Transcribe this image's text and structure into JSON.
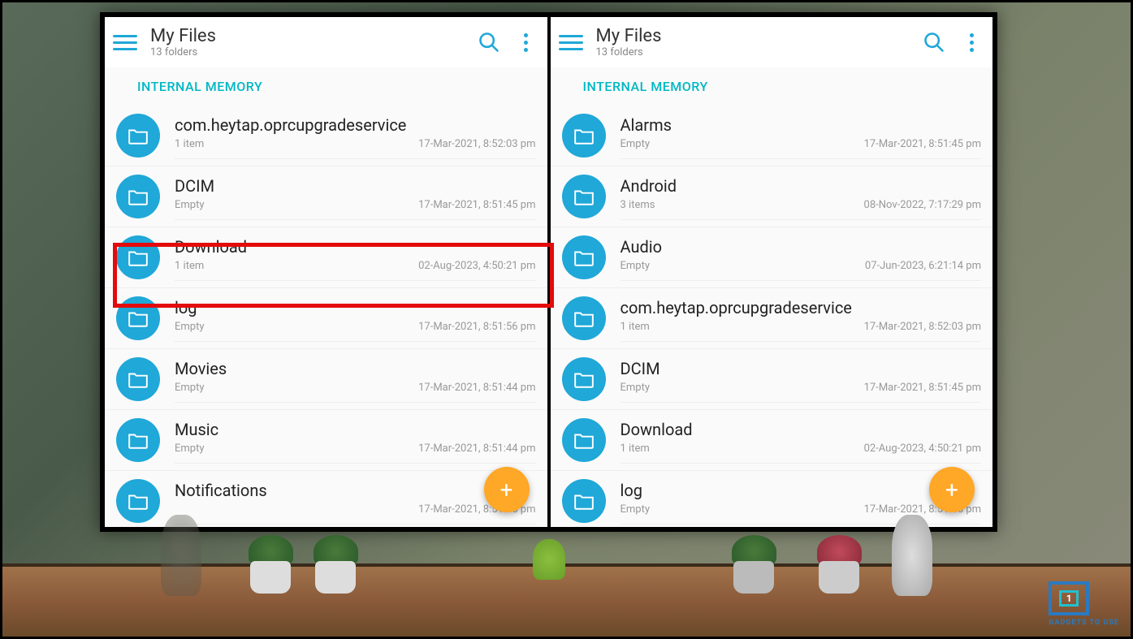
{
  "left": {
    "header": {
      "title": "My Files",
      "subtitle": "13 folders",
      "section": "INTERNAL MEMORY"
    },
    "items": [
      {
        "name": "com.heytap.oprcupgradeservice",
        "count": "1 item",
        "date": "17-Mar-2021, 8:52:03 pm"
      },
      {
        "name": "DCIM",
        "count": "Empty",
        "date": "17-Mar-2021, 8:51:45 pm"
      },
      {
        "name": "Download",
        "count": "1 item",
        "date": "02-Aug-2023, 4:50:21 pm"
      },
      {
        "name": "log",
        "count": "Empty",
        "date": "17-Mar-2021, 8:51:56 pm"
      },
      {
        "name": "Movies",
        "count": "Empty",
        "date": "17-Mar-2021, 8:51:44 pm"
      },
      {
        "name": "Music",
        "count": "Empty",
        "date": "17-Mar-2021, 8:51:44 pm"
      },
      {
        "name": "Notifications",
        "count": "",
        "date": "17-Mar-2021, 8:51:45 pm"
      }
    ]
  },
  "right": {
    "header": {
      "title": "My Files",
      "subtitle": "13 folders",
      "section": "INTERNAL MEMORY"
    },
    "items": [
      {
        "name": "Alarms",
        "count": "Empty",
        "date": "17-Mar-2021, 8:51:45 pm"
      },
      {
        "name": "Android",
        "count": "3 items",
        "date": "08-Nov-2022, 7:17:29 pm"
      },
      {
        "name": "Audio",
        "count": "Empty",
        "date": "07-Jun-2023, 6:21:14 pm"
      },
      {
        "name": "com.heytap.oprcupgradeservice",
        "count": "1 item",
        "date": "17-Mar-2021, 8:52:03 pm"
      },
      {
        "name": "DCIM",
        "count": "Empty",
        "date": "17-Mar-2021, 8:51:45 pm"
      },
      {
        "name": "Download",
        "count": "1 item",
        "date": "02-Aug-2023, 4:50:21 pm"
      },
      {
        "name": "log",
        "count": "Empty",
        "date": "17-Mar-2021, 8:51:45 pm"
      }
    ]
  },
  "watermark": "GADGETS TO USE"
}
